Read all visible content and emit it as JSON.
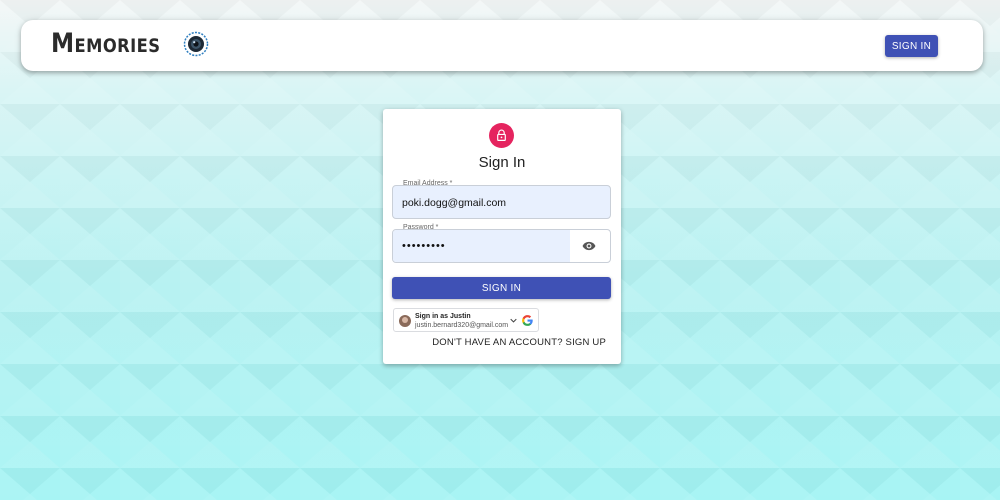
{
  "header": {
    "brand": "Memories",
    "brand_icon": "memories-logo-icon",
    "signin_button": "SIGN IN"
  },
  "form": {
    "title": "Sign In",
    "lock_icon": "lock-icon",
    "email": {
      "label": "Email Address *",
      "value": "poki.dogg@gmail.com"
    },
    "password": {
      "label": "Password *",
      "value": "•••••••••",
      "toggle_icon": "eye-icon"
    },
    "submit_label": "SIGN IN",
    "google": {
      "name_line": "Sign in as Justin",
      "email": "justin.bernard320@gmail.com"
    },
    "signup_link": "DON'T HAVE AN ACCOUNT? SIGN UP"
  },
  "colors": {
    "primary": "#3f51b5",
    "lock_avatar": "#e5245f",
    "autofill": "#e8f0fe"
  }
}
